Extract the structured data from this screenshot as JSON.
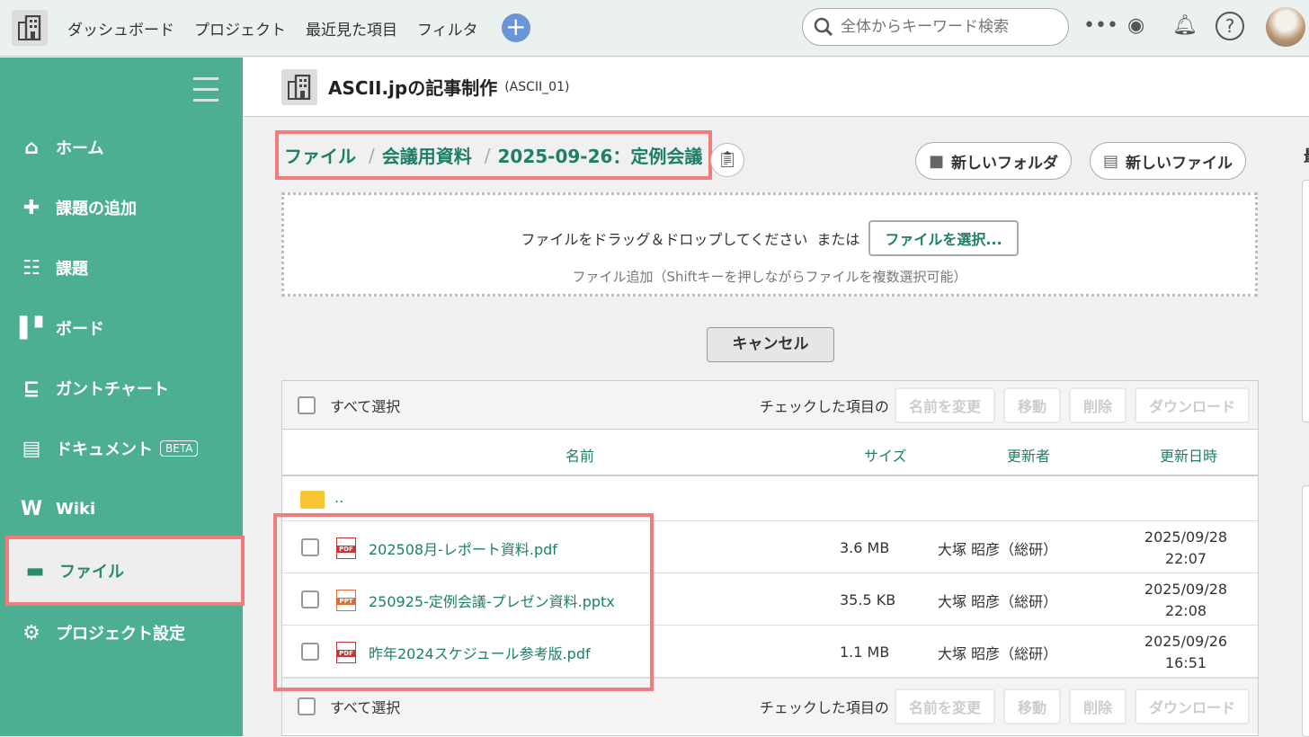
{
  "topbar": {
    "nav": [
      "ダッシュボード",
      "プロジェクト",
      "最近見た項目",
      "フィルタ"
    ],
    "search_placeholder": "全体からキーワード検索"
  },
  "sidebar": {
    "items": [
      {
        "label": "ホーム",
        "icon": "home-icon"
      },
      {
        "label": "課題の追加",
        "icon": "plus-icon"
      },
      {
        "label": "課題",
        "icon": "list-icon"
      },
      {
        "label": "ボード",
        "icon": "board-icon"
      },
      {
        "label": "ガントチャート",
        "icon": "gantt-icon"
      },
      {
        "label": "ドキュメント",
        "icon": "document-icon",
        "badge": "BETA"
      },
      {
        "label": "Wiki",
        "icon": "wiki-icon"
      },
      {
        "label": "ファイル",
        "icon": "folder-icon",
        "active": true
      },
      {
        "label": "プロジェクト設定",
        "icon": "gear-icon"
      }
    ]
  },
  "project": {
    "title": "ASCII.jpの記事制作",
    "key": "(ASCII_01)"
  },
  "breadcrumb": [
    "ファイル",
    "会議用資料",
    "2025-09-26：定例会議"
  ],
  "buttons": {
    "new_folder": "新しいフォルダ",
    "new_file": "新しいファイル",
    "cancel": "キャンセル"
  },
  "dropzone": {
    "text": "ファイルをドラッグ＆ドロップしてください",
    "or": "または",
    "select": "ファイルを選択...",
    "hint": "ファイル追加（Shiftキーを押しながらファイルを複数選択可能）"
  },
  "toolbar": {
    "select_all": "すべて選択",
    "checked_label": "チェックした項目の",
    "rename": "名前を変更",
    "move": "移動",
    "delete": "削除",
    "download": "ダウンロード"
  },
  "columns": {
    "name": "名前",
    "size": "サイズ",
    "user": "更新者",
    "date": "更新日時"
  },
  "parent": "..",
  "files": [
    {
      "name": "202508月-レポート資料.pdf",
      "type": "PDF",
      "size": "3.6 MB",
      "user": "大塚 昭彦（総研）",
      "date": "2025/09/28",
      "time": "22:07"
    },
    {
      "name": "250925-定例会議-プレゼン資料.pptx",
      "type": "PPT",
      "size": "35.5 KB",
      "user": "大塚 昭彦（総研）",
      "date": "2025/09/28",
      "time": "22:08"
    },
    {
      "name": "昨年2024スケジュール参考版.pdf",
      "type": "PDF",
      "size": "1.1 MB",
      "user": "大塚 昭彦（総研）",
      "date": "2025/09/26",
      "time": "16:51"
    }
  ],
  "right_panel": {
    "heading": "最"
  },
  "colors": {
    "sidebar": "#4caf92",
    "accent": "#1e7f67",
    "highlight": "#f07c7c"
  }
}
